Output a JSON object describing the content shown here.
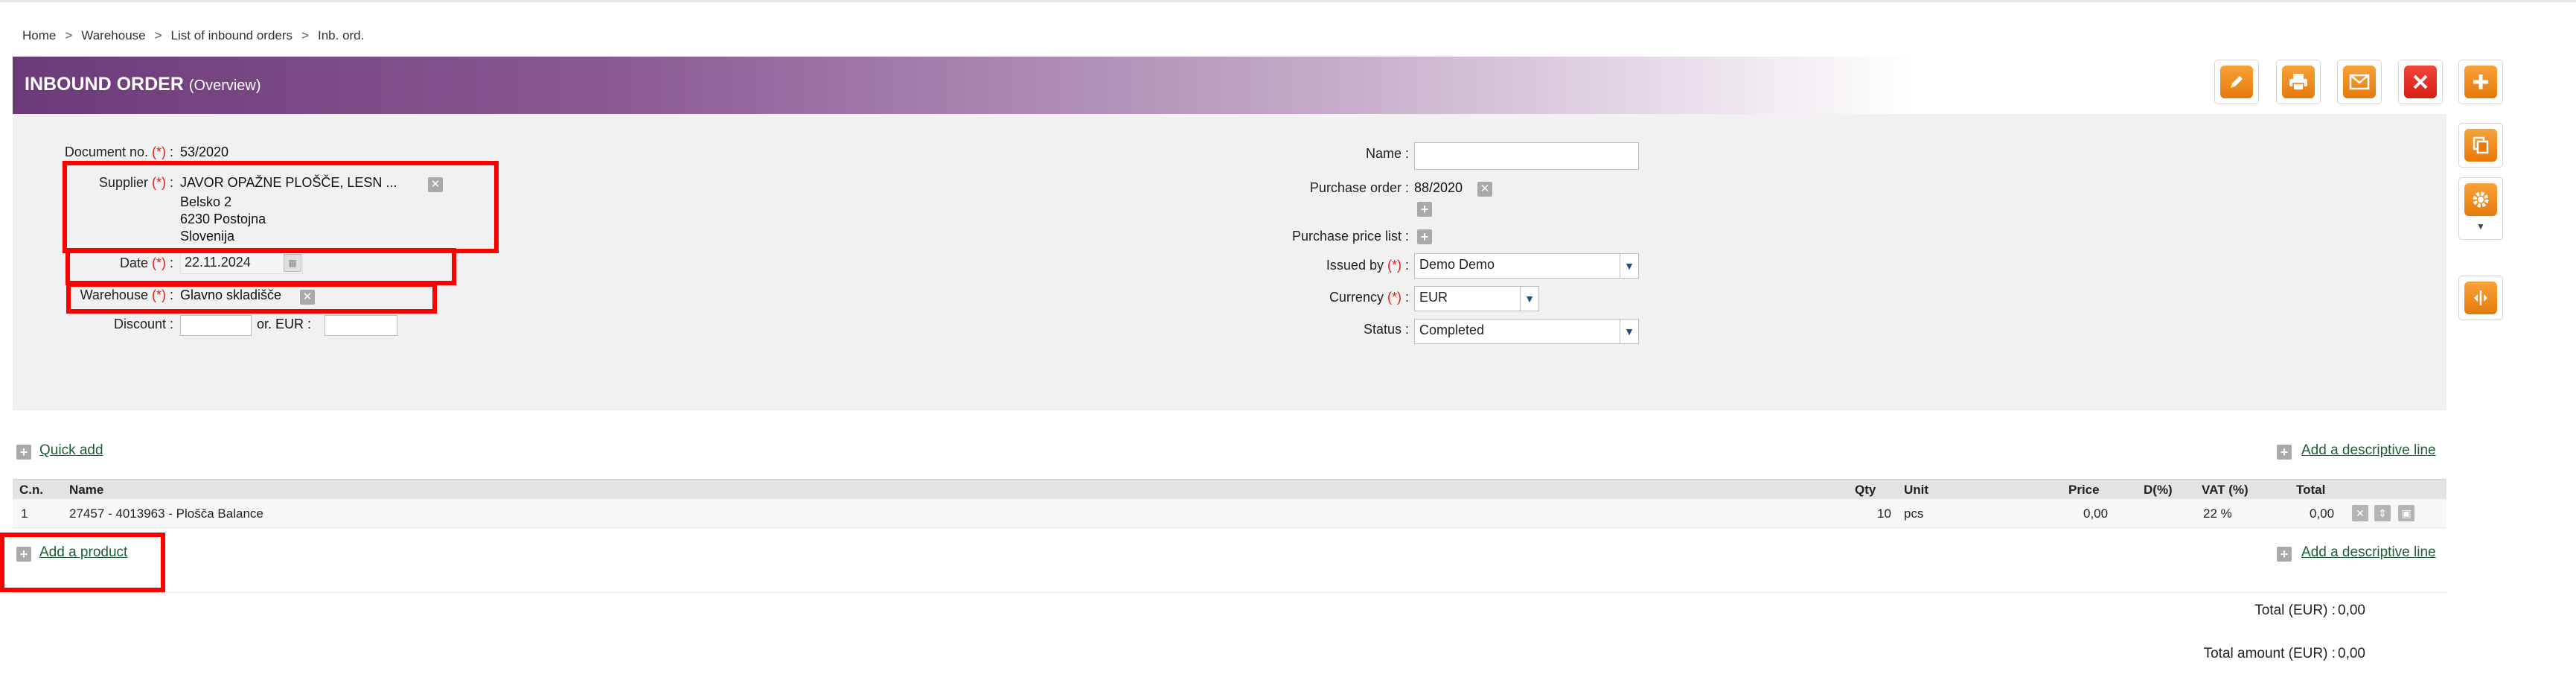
{
  "breadcrumb": [
    "Home",
    "Warehouse",
    "List of inbound orders",
    "Inb. ord."
  ],
  "header": {
    "title": "INBOUND ORDER",
    "subtitle": "(Overview)"
  },
  "toolbar": {
    "edit_icon": "pencil-icon",
    "print_icon": "printer-icon",
    "email_icon": "envelope-icon",
    "delete_icon": "close-icon",
    "add_icon": "plus-icon",
    "copy_icon": "copy-icon",
    "settings_icon": "gear-icon",
    "split_icon": "split-icon"
  },
  "form": {
    "document_no": {
      "label": "Document no.",
      "required": "(*)",
      "value": "53/2020"
    },
    "supplier": {
      "label": "Supplier",
      "required": "(*)",
      "name": "JAVOR OPAŽNE PLOŠČE, LESN ...",
      "address1": "Belsko 2",
      "address2": "6230 Postojna",
      "country": "Slovenija"
    },
    "date": {
      "label": "Date",
      "required": "(*)",
      "value": "22.11.2024"
    },
    "warehouse": {
      "label": "Warehouse",
      "required": "(*)",
      "value": "Glavno skladišče"
    },
    "discount": {
      "label": "Discount :",
      "or_label": "or. EUR :"
    },
    "name": {
      "label": "Name :",
      "value": ""
    },
    "purchase_order": {
      "label": "Purchase order :",
      "value": "88/2020"
    },
    "purchase_price_list": {
      "label": "Purchase price list :"
    },
    "issued_by": {
      "label": "Issued by",
      "required": "(*)",
      "value": "Demo Demo"
    },
    "currency": {
      "label": "Currency",
      "required": "(*)",
      "value": "EUR"
    },
    "status": {
      "label": "Status :",
      "value": "Completed"
    }
  },
  "links": {
    "quick_add": "Quick add",
    "add_descriptive_line": "Add a descriptive line",
    "add_product": "Add a product"
  },
  "table": {
    "columns": [
      "C.n.",
      "Name",
      "Qty",
      "Unit",
      "Price",
      "D(%)",
      "VAT (%)",
      "Total"
    ],
    "rows": [
      {
        "cn": "1",
        "name": "27457 - 4013963 - Plošča Balance",
        "qty": "10",
        "unit": "pcs",
        "price": "0,00",
        "discount": "",
        "vat": "22 %",
        "total": "0,00"
      }
    ]
  },
  "totals": {
    "total_label": "Total (EUR) :",
    "total_value": "0,00",
    "amount_label": "Total amount (EUR) :",
    "amount_value": "0,00"
  }
}
